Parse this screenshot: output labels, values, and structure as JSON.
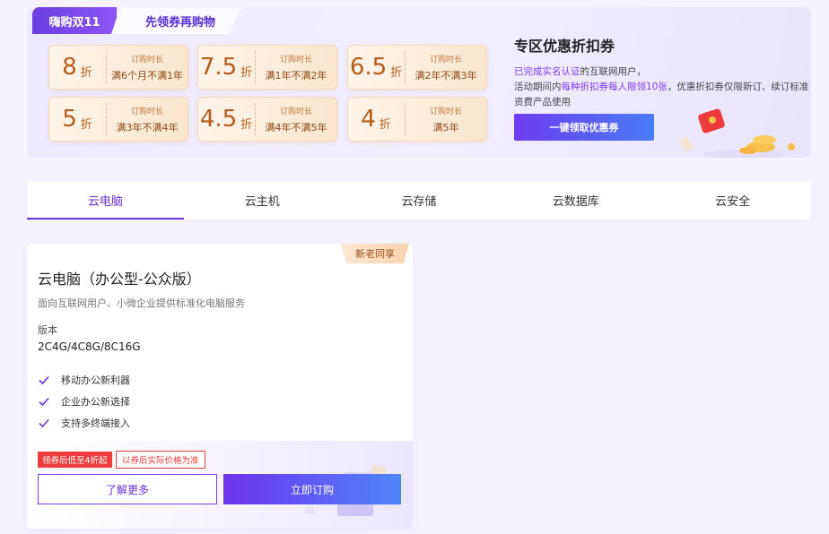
{
  "banner": {
    "tab_label": "嗨购双11",
    "tab_sub_label": "先领券再购物",
    "coupons": [
      {
        "num": "8",
        "unit": "折",
        "label": "订购时长",
        "term": "满6个月不满1年"
      },
      {
        "num": "7.5",
        "unit": "折",
        "label": "订购时长",
        "term": "满1年不满2年"
      },
      {
        "num": "6.5",
        "unit": "折",
        "label": "订购时长",
        "term": "满2年不满3年"
      },
      {
        "num": "5",
        "unit": "折",
        "label": "订购时长",
        "term": "满3年不满4年"
      },
      {
        "num": "4.5",
        "unit": "折",
        "label": "订购时长",
        "term": "满4年不满5年"
      },
      {
        "num": "4",
        "unit": "折",
        "label": "订购时长",
        "term": "满5年"
      }
    ],
    "title": "专区优惠折扣券",
    "desc_hl1": "已完成实名认证",
    "desc_1": "的互联网用户，",
    "desc_2": "活动期间内",
    "desc_hl2": "每种折扣券每人限领10张",
    "desc_3": "，优惠折扣券仅限新订、续订标准资费产品使用",
    "claim_button": "一键领取优惠券"
  },
  "tabs": [
    {
      "label": "云电脑",
      "active": true
    },
    {
      "label": "云主机",
      "active": false
    },
    {
      "label": "云存储",
      "active": false
    },
    {
      "label": "云数据库",
      "active": false
    },
    {
      "label": "云安全",
      "active": false
    }
  ],
  "card": {
    "ribbon": "新老同享",
    "title": "云电脑（办公型-公众版）",
    "subtitle": "面向互联网用户、小微企业提供标准化电脑服务",
    "version_label": "版本",
    "version_value": "2C4G/4C8G/8C16G",
    "features": [
      "移动办公新利器",
      "企业办公新选择",
      "支持多终端接入"
    ],
    "tag_red": "领券后低至4折起",
    "tag_outline": "以券后实际价格为准",
    "more_button": "了解更多",
    "buy_button": "立即订购"
  },
  "colors": {
    "accent": "#6a31d6",
    "coupon_text": "#b55d18",
    "tag_red": "#ec3c3c"
  }
}
